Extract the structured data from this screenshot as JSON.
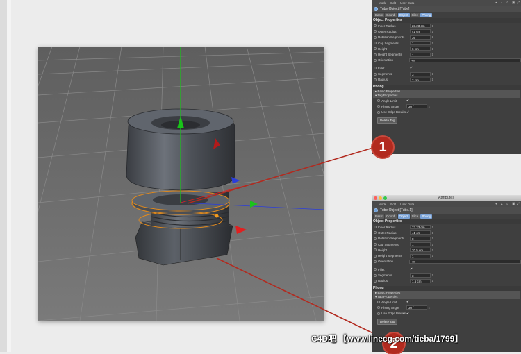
{
  "panel1": {
    "window_title": "",
    "menu": [
      "Mode",
      "Edit",
      "User Data"
    ],
    "object_name": "Tube Object [Tube]",
    "tabs": [
      "Basic",
      "Coord.",
      "Object",
      "Slice",
      "Phong"
    ],
    "section_object": "Object Properties",
    "fields": [
      {
        "label": "Inner Radius",
        "value": "23.23 cm"
      },
      {
        "label": "Outer Radius",
        "value": "41 cm"
      },
      {
        "label": "Rotation Segments",
        "value": "36"
      },
      {
        "label": "Cap Segments",
        "value": "1"
      },
      {
        "label": "Height",
        "value": "6 cm"
      },
      {
        "label": "Height Segments",
        "value": "1"
      },
      {
        "label": "Orientation",
        "value": "+Y"
      }
    ],
    "fillet_fields": [
      {
        "label": "Fillet",
        "value": "✔"
      },
      {
        "label": "Segments",
        "value": "3"
      },
      {
        "label": "Radius",
        "value": "2 cm"
      }
    ],
    "section_phong": "Phong",
    "basic_properties": "▸ Basic Properties",
    "tag_properties": "▾ Tag Properties",
    "tag_fields": [
      {
        "label": "Angle Limit",
        "value": "✔"
      },
      {
        "label": "Phong Angle",
        "value": "30 °"
      },
      {
        "label": "Use Edge Breaks",
        "value": "✔"
      }
    ],
    "delete_tag": "Delete Tag"
  },
  "panel2": {
    "window_title": "Attributes",
    "menu": [
      "Mode",
      "Edit",
      "User Data"
    ],
    "object_name": "Tube Object [Tube.1]",
    "tabs": [
      "Basic",
      "Coord.",
      "Object",
      "Slice",
      "Phong"
    ],
    "section_object": "Object Properties",
    "fields": [
      {
        "label": "Inner Radius",
        "value": "23.23 cm"
      },
      {
        "label": "Outer Radius",
        "value": "41 cm"
      },
      {
        "label": "Rotation Segments",
        "value": "8"
      },
      {
        "label": "Cap Segments",
        "value": "1"
      },
      {
        "label": "Height",
        "value": "20.5 cm"
      },
      {
        "label": "Height Segments",
        "value": "1"
      },
      {
        "label": "Orientation",
        "value": "+Y"
      }
    ],
    "fillet_fields": [
      {
        "label": "Fillet",
        "value": "✔"
      },
      {
        "label": "Segments",
        "value": "3"
      },
      {
        "label": "Radius",
        "value": "1.5 cm"
      }
    ],
    "section_phong": "Phong",
    "basic_properties": "▸ Basic Properties",
    "tag_properties": "▾ Tag Properties",
    "tag_fields": [
      {
        "label": "Angle Limit",
        "value": "✔"
      },
      {
        "label": "Phong Angle",
        "value": "30 °"
      },
      {
        "label": "Use Edge Breaks",
        "value": "✔"
      }
    ],
    "delete_tag": "Delete Tag"
  },
  "callouts": [
    "1",
    "2"
  ],
  "watermark": "C4D吧 【www.linecg.com/tieba/1799】",
  "colors": {
    "callout": "#b22a1f",
    "panel_bg": "#3f3f3f",
    "active_tab": "#7aa2d6",
    "selection_outline": "#e08a1e",
    "axis_y": "#19c419",
    "axis_x": "#e02020",
    "axis_z": "#2a3ddc"
  }
}
